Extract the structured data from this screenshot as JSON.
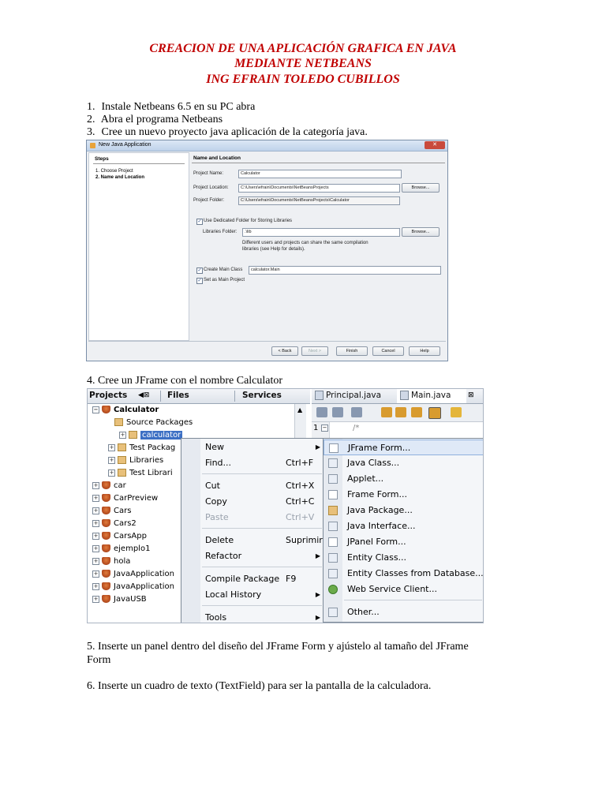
{
  "header": {
    "line1": "CREACION DE UNA APLICACIÓN GRAFICA EN JAVA",
    "line2": "MEDIANTE NETBEANS",
    "line3": "ING  EFRAIN TOLEDO CUBILLOS"
  },
  "steps": [
    {
      "num": "1.",
      "text": "Instale Netbeans 6.5 en su PC abra"
    },
    {
      "num": "2.",
      "text": "Abra el programa Netbeans"
    },
    {
      "num": "3.",
      "text": "Cree un nuevo proyecto java aplicación de la categoría java."
    }
  ],
  "dialog": {
    "title": "New Java Application",
    "steps_heading": "Steps",
    "steps": [
      "1.   Choose Project",
      "2.   Name and Location"
    ],
    "section_heading": "Name and Location",
    "project_name_label": "Project Name:",
    "project_name_value": "Calculator",
    "project_location_label": "Project Location:",
    "project_location_value": "C:\\Users\\efrain\\Documents\\NetBeansProjects",
    "project_folder_label": "Project Folder:",
    "project_folder_value": "C:\\Users\\efrain\\Documents\\NetBeansProjects\\Calculator",
    "browse_label": "Browse...",
    "dedicated_folder_label": "Use Dedicated Folder for Storing Libraries",
    "libraries_folder_label": "Libraries Folder:",
    "libraries_folder_value": ".\\lib",
    "libraries_note_1": "Different users and projects can share the same compilation",
    "libraries_note_2": "libraries (see Help for details).",
    "create_main_label": "Create Main Class",
    "create_main_value": "calculator.Main",
    "set_main_label": "Set as Main Project",
    "back_label": "< Back",
    "next_label": "Next >",
    "finish_label": "Finish",
    "cancel_label": "Cancel",
    "help_label": "Help"
  },
  "step4": "4. Cree un JFrame con el nombre Calculator",
  "ide": {
    "tab_projects": "Projects",
    "tab_files": "Files",
    "tab_services": "Services",
    "editor_tab_1": "Principal.java",
    "editor_tab_2": "Main.java",
    "line_number": "1",
    "code_snippet": "/*",
    "tree": [
      {
        "label": "Calculator",
        "type": "project"
      },
      {
        "label": "Source Packages",
        "type": "folder"
      },
      {
        "label": "calculator",
        "type": "package"
      },
      {
        "label": "Test Packag",
        "type": "folder"
      },
      {
        "label": "Libraries",
        "type": "folder"
      },
      {
        "label": "Test Librari",
        "type": "folder"
      },
      {
        "label": "car",
        "type": "project"
      },
      {
        "label": "CarPreview",
        "type": "project"
      },
      {
        "label": "Cars",
        "type": "project"
      },
      {
        "label": "Cars2",
        "type": "project"
      },
      {
        "label": "CarsApp",
        "type": "project"
      },
      {
        "label": "ejemplo1",
        "type": "project"
      },
      {
        "label": "hola",
        "type": "project"
      },
      {
        "label": "JavaApplication",
        "type": "project"
      },
      {
        "label": "JavaApplication",
        "type": "project"
      },
      {
        "label": "JavaUSB",
        "type": "project"
      }
    ],
    "context_menu": [
      {
        "label": "New",
        "shortcut": "",
        "submenu": true
      },
      {
        "label": "Find...",
        "shortcut": "Ctrl+F"
      },
      {
        "label": "Cut",
        "shortcut": "Ctrl+X"
      },
      {
        "label": "Copy",
        "shortcut": "Ctrl+C"
      },
      {
        "label": "Paste",
        "shortcut": "Ctrl+V",
        "disabled": true
      },
      {
        "label": "Delete",
        "shortcut": "Suprimir"
      },
      {
        "label": "Refactor",
        "shortcut": "",
        "submenu": true
      },
      {
        "label": "Compile Package",
        "shortcut": "F9"
      },
      {
        "label": "Local History",
        "shortcut": "",
        "submenu": true
      },
      {
        "label": "Tools",
        "shortcut": "",
        "submenu": true
      }
    ],
    "submenu": [
      "JFrame Form...",
      "Java Class...",
      "Applet...",
      "Frame Form...",
      "Java Package...",
      "Java Interface...",
      "JPanel Form...",
      "Entity Class...",
      "Entity Classes from Database...",
      "Web Service Client...",
      "Other..."
    ]
  },
  "step5_line1": "5. Inserte un panel dentro del diseño del JFrame Form  y ajústelo al tamaño del JFrame",
  "step5_line2": "Form",
  "step6": "6. Inserte un cuadro de texto (TextField) para ser la pantalla de la calculadora.",
  "colors": {
    "title": "#c00000",
    "selection": "#3c6fc4"
  }
}
